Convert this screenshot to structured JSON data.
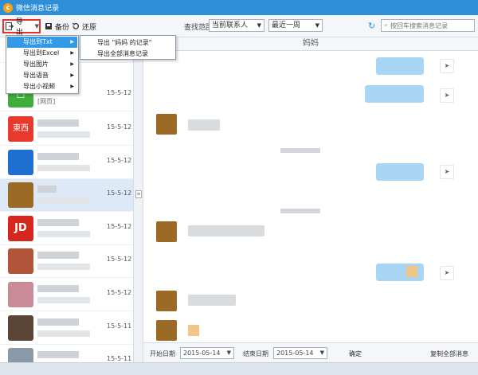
{
  "window": {
    "title": "微信消息记录"
  },
  "toolbar": {
    "export_label": "导出",
    "backup_label": "备份",
    "restore_label": "还原",
    "range_label": "查找范围：",
    "contact_select": "当前联系人",
    "period_select": "最近一周",
    "search_placeholder": "按回车搜索消息记录"
  },
  "export_menu": {
    "items": [
      {
        "label": "导出到Txt"
      },
      {
        "label": "导出到Excel"
      },
      {
        "label": "导出图片"
      },
      {
        "label": "导出语音"
      },
      {
        "label": "导出小视频"
      }
    ],
    "submenu": [
      {
        "label": "导出 \"妈妈 的记录\""
      },
      {
        "label": "导出全部消息记录"
      }
    ]
  },
  "contacts": [
    {
      "date": "15-5-12"
    },
    {
      "date": "15-5-12",
      "preview": "[网页]"
    },
    {
      "date": "15-5-12",
      "avatar_text": "東西"
    },
    {
      "date": "15-5-12"
    },
    {
      "date": "15-5-12"
    },
    {
      "date": "15-5-12",
      "avatar_text": "JD"
    },
    {
      "date": "15-5-12"
    },
    {
      "date": "15-5-12"
    },
    {
      "date": "15-5-11"
    },
    {
      "date": "15-5-11"
    }
  ],
  "chat": {
    "contact_name": "妈妈"
  },
  "bottom_bar": {
    "start_label": "开始日期",
    "start_date": "2015-05-14",
    "end_label": "结束日期",
    "end_date": "2015-05-14",
    "confirm_label": "确定",
    "copy_all_label": "复制全部消息"
  },
  "colors": {
    "titlebar": "#2f8fd6",
    "highlight_border": "#e8312a",
    "menu_active": "#3399e6",
    "self_bubble": "#a9d6f5"
  }
}
